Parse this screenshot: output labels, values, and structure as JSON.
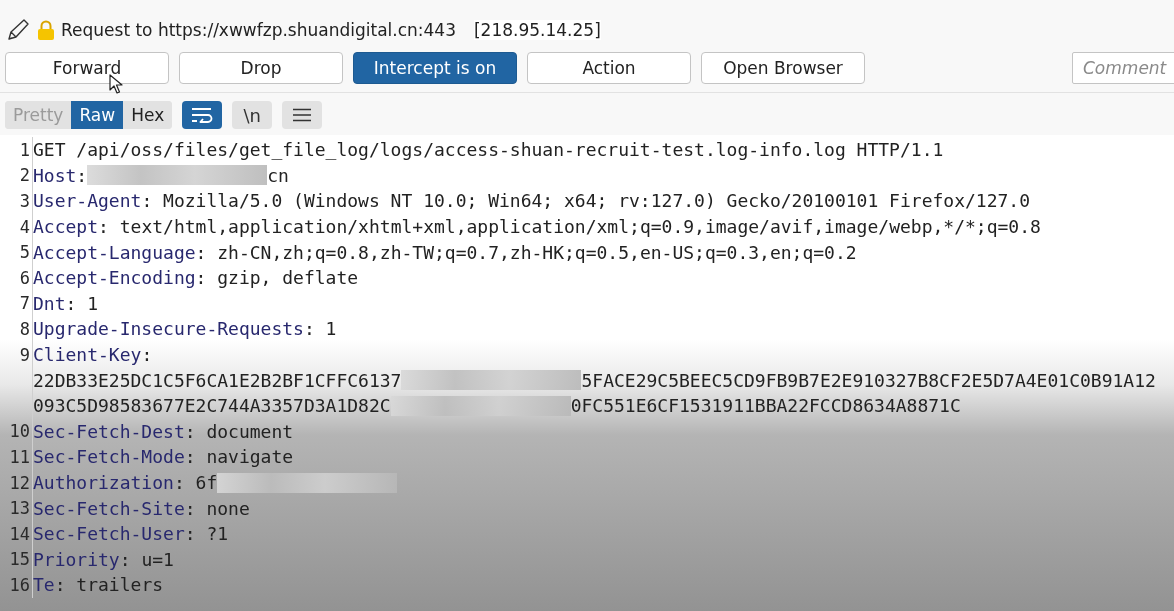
{
  "header": {
    "title": "Request to https://xwwfzp.shuandigital.cn:443",
    "address": "[218.95.14.25]"
  },
  "actions": [
    {
      "label": "Forward",
      "kind": "button"
    },
    {
      "label": "Drop",
      "kind": "button"
    },
    {
      "label": "Intercept is on",
      "kind": "toggle",
      "on": true
    },
    {
      "label": "Action",
      "kind": "button"
    },
    {
      "label": "Open Browser",
      "kind": "button"
    }
  ],
  "comment": {
    "placeholder": "Comment"
  },
  "view_tabs": [
    {
      "label": "Pretty",
      "selected": false,
      "disabled": true
    },
    {
      "label": "Raw",
      "selected": true,
      "disabled": false
    },
    {
      "label": "Hex",
      "selected": false,
      "disabled": false
    }
  ],
  "wrap_toggle": {
    "on": true
  },
  "newline_toggle": {
    "label": "\\n",
    "on": false
  },
  "editor": {
    "lines": [
      {
        "number": "1",
        "parts": [
          {
            "kind": "text",
            "text": "GET /api/oss/files/get_file_log/logs/access-shuan-recruit-test.log-info.log HTTP/1.1"
          }
        ]
      },
      {
        "number": "2",
        "parts": [
          {
            "kind": "name",
            "text": "Host"
          },
          {
            "kind": "text",
            "text": ": "
          },
          {
            "kind": "redacted"
          },
          {
            "kind": "text",
            "text": "cn"
          }
        ]
      },
      {
        "number": "3",
        "parts": [
          {
            "kind": "name",
            "text": "User-Agent"
          },
          {
            "kind": "text",
            "text": ": Mozilla/5.0 (Windows NT 10.0; Win64; x64; rv:127.0) Gecko/20100101 Firefox/127.0"
          }
        ]
      },
      {
        "number": "4",
        "parts": [
          {
            "kind": "name",
            "text": "Accept"
          },
          {
            "kind": "text",
            "text": ": text/html,application/xhtml+xml,application/xml;q=0.9,image/avif,image/webp,*/*;q=0.8"
          }
        ]
      },
      {
        "number": "5",
        "parts": [
          {
            "kind": "name",
            "text": "Accept-Language"
          },
          {
            "kind": "text",
            "text": ": zh-CN,zh;q=0.8,zh-TW;q=0.7,zh-HK;q=0.5,en-US;q=0.3,en;q=0.2"
          }
        ]
      },
      {
        "number": "6",
        "parts": [
          {
            "kind": "name",
            "text": "Accept-Encoding"
          },
          {
            "kind": "text",
            "text": ": gzip, deflate"
          }
        ]
      },
      {
        "number": "7",
        "parts": [
          {
            "kind": "name",
            "text": "Dnt"
          },
          {
            "kind": "text",
            "text": ": 1"
          }
        ]
      },
      {
        "number": "8",
        "parts": [
          {
            "kind": "name",
            "text": "Upgrade-Insecure-Requests"
          },
          {
            "kind": "text",
            "text": ": 1"
          }
        ]
      },
      {
        "number": "9",
        "parts": [
          {
            "kind": "name",
            "text": "Client-Key"
          },
          {
            "kind": "text",
            "text": ":"
          }
        ]
      },
      {
        "parts": [
          {
            "kind": "text",
            "text": "22DB33E25DC1C5F6CA1E2B2BF1CFFC6137"
          },
          {
            "kind": "redacted"
          },
          {
            "kind": "text",
            "text": "5FACE29C5BEEC5CD9FB9B7E2E910327B8CF2E5D7A4E01C0B91A12"
          }
        ]
      },
      {
        "parts": [
          {
            "kind": "text",
            "text": "093C5D98583677E2C744A3357D3A1D82C"
          },
          {
            "kind": "redacted"
          },
          {
            "kind": "text",
            "text": "0FC551E6CF1531911BBA22FCCD8634A8871C"
          }
        ]
      },
      {
        "number": "10",
        "parts": [
          {
            "kind": "name",
            "text": "Sec-Fetch-Dest"
          },
          {
            "kind": "text",
            "text": ": document"
          }
        ]
      },
      {
        "number": "11",
        "parts": [
          {
            "kind": "name",
            "text": "Sec-Fetch-Mode"
          },
          {
            "kind": "text",
            "text": ": navigate"
          }
        ]
      },
      {
        "number": "12",
        "parts": [
          {
            "kind": "name",
            "text": "Authorization"
          },
          {
            "kind": "text",
            "text": ": 6f"
          },
          {
            "kind": "redacted"
          }
        ]
      },
      {
        "number": "13",
        "parts": [
          {
            "kind": "name",
            "text": "Sec-Fetch-Site"
          },
          {
            "kind": "text",
            "text": ": none"
          }
        ]
      },
      {
        "number": "14",
        "parts": [
          {
            "kind": "name",
            "text": "Sec-Fetch-User"
          },
          {
            "kind": "text",
            "text": ": ?1"
          }
        ]
      },
      {
        "number": "15",
        "parts": [
          {
            "kind": "name",
            "text": "Priority"
          },
          {
            "kind": "text",
            "text": ": u=1"
          }
        ]
      },
      {
        "number": "16",
        "parts": [
          {
            "kind": "name",
            "text": "Te"
          },
          {
            "kind": "text",
            "text": ": trailers"
          }
        ]
      }
    ]
  }
}
